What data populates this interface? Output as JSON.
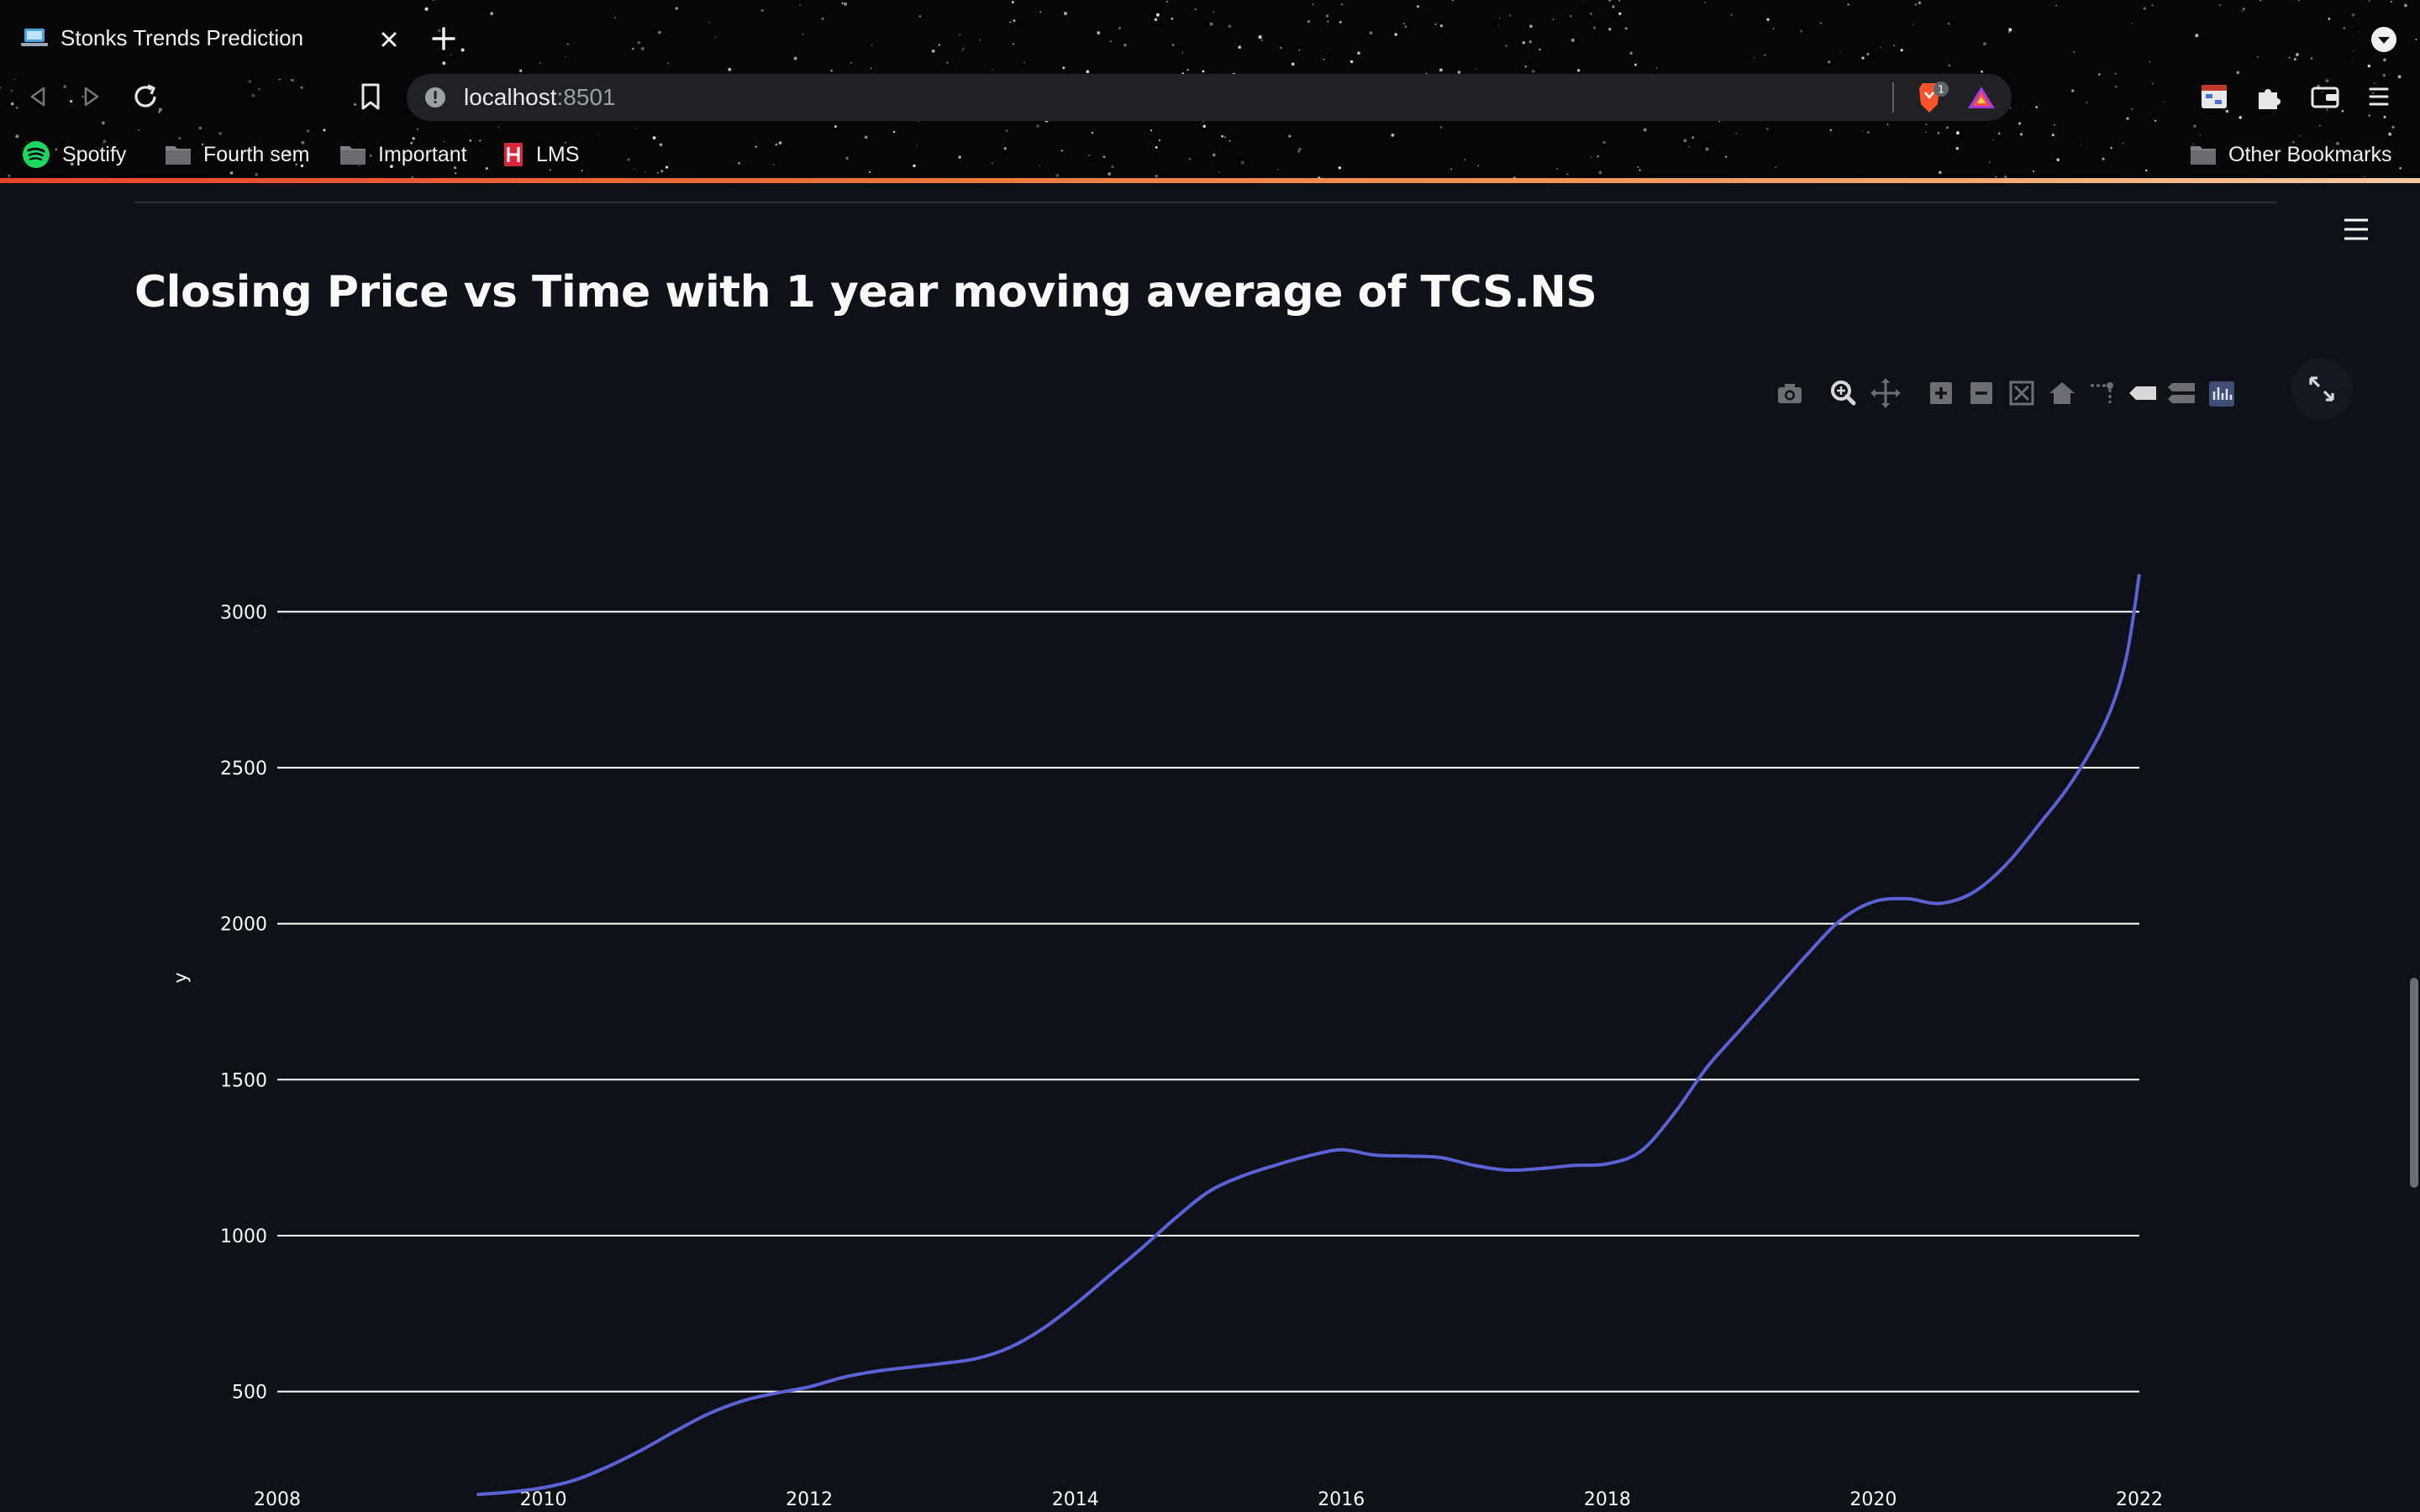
{
  "browser": {
    "tab_title": "Stonks Trends Prediction",
    "url_host": "localhost",
    "url_port": ":8501",
    "shield_badge": "1",
    "bookmarks": [
      {
        "label": "Spotify",
        "icon": "spotify-icon"
      },
      {
        "label": "Fourth sem",
        "icon": "folder-icon"
      },
      {
        "label": "Important",
        "icon": "folder-icon"
      },
      {
        "label": "LMS",
        "icon": "lms-icon"
      }
    ],
    "other_bookmarks": "Other Bookmarks"
  },
  "page": {
    "title": "Closing Price vs Time with 1 year moving average of TCS.NS"
  },
  "modebar": [
    "camera-icon",
    "zoom-icon",
    "pan-icon",
    "zoom-in-icon",
    "zoom-out-icon",
    "autoscale-icon",
    "reset-axes-icon",
    "spike-lines-icon",
    "hover-closest-icon",
    "hover-compare-icon",
    "plotly-logo-icon"
  ],
  "colors": {
    "background": "#0e1117",
    "line": "#5a62d6",
    "grid": "#ffffff",
    "accent_start": "#e8452c"
  },
  "chart_data": {
    "type": "line",
    "title": "",
    "xlabel": "",
    "ylabel": "y",
    "xlim": [
      2008,
      2022
    ],
    "ylim": [
      130,
      3200
    ],
    "xticks": [
      "2008",
      "2010",
      "2012",
      "2014",
      "2016",
      "2018",
      "2020",
      "2022"
    ],
    "yticks": [
      "500",
      "1000",
      "1500",
      "2000",
      "2500",
      "3000"
    ],
    "grid": true,
    "series": [
      {
        "name": "",
        "x": [
          2009.5,
          2009.75,
          2010.0,
          2010.25,
          2010.5,
          2010.75,
          2011.0,
          2011.25,
          2011.5,
          2011.75,
          2012.0,
          2012.25,
          2012.5,
          2012.75,
          2013.0,
          2013.25,
          2013.5,
          2013.75,
          2014.0,
          2014.25,
          2014.5,
          2014.75,
          2015.0,
          2015.25,
          2015.5,
          2015.75,
          2016.0,
          2016.25,
          2016.5,
          2016.75,
          2017.0,
          2017.25,
          2017.5,
          2017.75,
          2018.0,
          2018.25,
          2018.5,
          2018.75,
          2019.0,
          2019.25,
          2019.5,
          2019.75,
          2020.0,
          2020.25,
          2020.5,
          2020.75,
          2021.0,
          2021.25,
          2021.5,
          2021.75,
          2021.9,
          2022.0
        ],
        "y": [
          170,
          178,
          192,
          218,
          262,
          315,
          375,
          430,
          470,
          495,
          515,
          545,
          565,
          578,
          590,
          605,
          640,
          700,
          780,
          870,
          960,
          1055,
          1140,
          1190,
          1225,
          1255,
          1275,
          1258,
          1255,
          1250,
          1225,
          1210,
          1215,
          1225,
          1230,
          1270,
          1390,
          1540,
          1660,
          1780,
          1900,
          2010,
          2070,
          2080,
          2065,
          2100,
          2190,
          2320,
          2460,
          2650,
          2850,
          3120
        ]
      }
    ]
  }
}
